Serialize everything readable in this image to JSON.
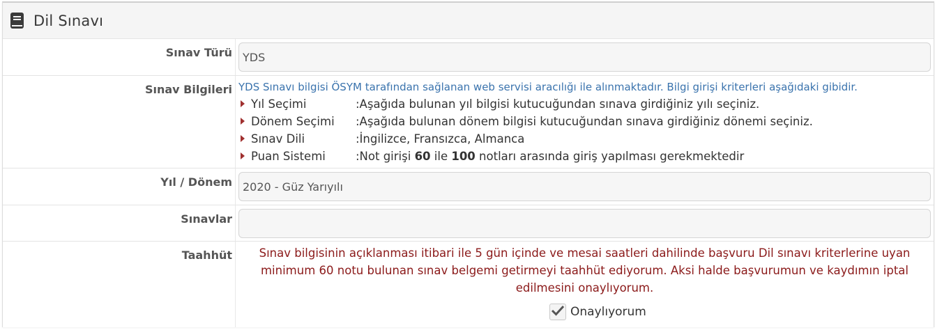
{
  "panel": {
    "title": "Dil Sınavı",
    "icon": "book-icon"
  },
  "rows": {
    "exam_type": {
      "label": "Sınav Türü",
      "value": "YDS"
    },
    "exam_info": {
      "label": "Sınav Bilgileri",
      "intro": "YDS Sınavı bilgisi ÖSYM tarafından sağlanan web servisi aracılığı ile alınmaktadır. Bilgi girişi kriterleri aşağıdaki gibidir.",
      "criteria": [
        {
          "name": "Yıl Seçimi",
          "text": ":Aşağıda bulunan yıl bilgisi kutucuğundan sınava girdiğiniz yılı seçiniz."
        },
        {
          "name": "Dönem Seçimi",
          "text": ":Aşağıda bulunan dönem bilgisi kutucuğundan sınava girdiğiniz dönemi seçiniz."
        },
        {
          "name": "Sınav Dili",
          "text": ":İngilizce, Fransızca, Almanca"
        },
        {
          "name": "Puan Sistemi",
          "text_before": ":Not girişi ",
          "min": "60",
          "text_mid": " ile ",
          "max": "100",
          "text_after": " notları arasında giriş yapılması gerekmektedir"
        }
      ]
    },
    "year_term": {
      "label": "Yıl / Dönem",
      "value": "2020 - Güz Yarıyılı"
    },
    "exams": {
      "label": "Sınavlar",
      "value": ""
    },
    "pledge": {
      "label": "Taahhüt",
      "text": "Sınav bilgisinin açıklanması itibari ile 5 gün içinde ve mesai saatleri dahilinde başvuru Dil sınavı kriterlerine uyan minimum 60 notu bulunan sınav belgemi getirmeyi taahhüt ediyorum. Aksi halde başvurumun ve kaydımın iptal edilmesini onaylıyorum.",
      "approve_label": "Onaylıyorum",
      "approved": true
    }
  },
  "colors": {
    "link_blue": "#3a73ad",
    "pledge_red": "#8b1a1a",
    "arrow": "#a0302f"
  }
}
